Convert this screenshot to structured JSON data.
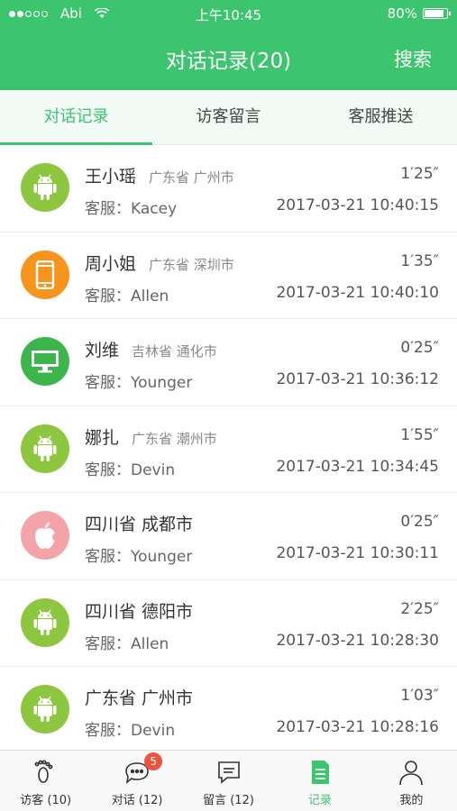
{
  "status_bar": {
    "carrier": "Abi",
    "time": "上午10:45",
    "battery_text": "80%",
    "battery_level": 0.8,
    "signal_bars_filled": 2,
    "signal_bars_total": 5
  },
  "header": {
    "title": "对话记录(20)",
    "search_label": "搜索"
  },
  "tabs": [
    {
      "label": "对话记录",
      "active": true
    },
    {
      "label": "访客留言",
      "active": false
    },
    {
      "label": "客服推送",
      "active": false
    }
  ],
  "conversations": [
    {
      "name": "王小瑶",
      "region": "广东省 广州市",
      "duration": "1′25″",
      "agent": "客服：Kacey",
      "datetime": "2017-03-21  10:40:15",
      "device": "android",
      "color": "#8dc63f"
    },
    {
      "name": "周小姐",
      "region": "广东省 深圳市",
      "duration": "1′35″",
      "agent": "客服：Allen",
      "datetime": "2017-03-21  10:40:10",
      "device": "phone",
      "color": "#f7941d"
    },
    {
      "name": "刘维",
      "region": "吉林省 通化市",
      "duration": "0′25″",
      "agent": "客服：Younger",
      "datetime": "2017-03-21  10:36:12",
      "device": "desktop",
      "color": "#3cb54a"
    },
    {
      "name": "娜扎",
      "region": "广东省 潮州市",
      "duration": "1′55″",
      "agent": "客服：Devin",
      "datetime": "2017-03-21  10:34:45",
      "device": "android",
      "color": "#8dc63f"
    },
    {
      "name": "四川省 成都市",
      "region": "",
      "duration": "0′25″",
      "agent": "客服：Younger",
      "datetime": "2017-03-21  10:30:11",
      "device": "apple",
      "color": "#f4a3a8"
    },
    {
      "name": "四川省 德阳市",
      "region": "",
      "duration": "2′25″",
      "agent": "客服：Allen",
      "datetime": "2017-03-21  10:28:30",
      "device": "android",
      "color": "#8dc63f"
    },
    {
      "name": "广东省 广州市",
      "region": "",
      "duration": "1′03″",
      "agent": "客服：Devin",
      "datetime": "2017-03-21  10:28:16",
      "device": "android",
      "color": "#8dc63f"
    }
  ],
  "bottom_nav": [
    {
      "label": "访客 (10)",
      "icon": "footprint-icon",
      "active": false
    },
    {
      "label": "对话 (12)",
      "icon": "chat-bubble-icon",
      "active": false,
      "badge": "5"
    },
    {
      "label": "留言 (12)",
      "icon": "message-icon",
      "active": false
    },
    {
      "label": "记录",
      "icon": "record-doc-icon",
      "active": true
    },
    {
      "label": "我的",
      "icon": "user-icon",
      "active": false
    }
  ],
  "colors": {
    "accent": "#3cc46f",
    "badge": "#f0533d"
  }
}
